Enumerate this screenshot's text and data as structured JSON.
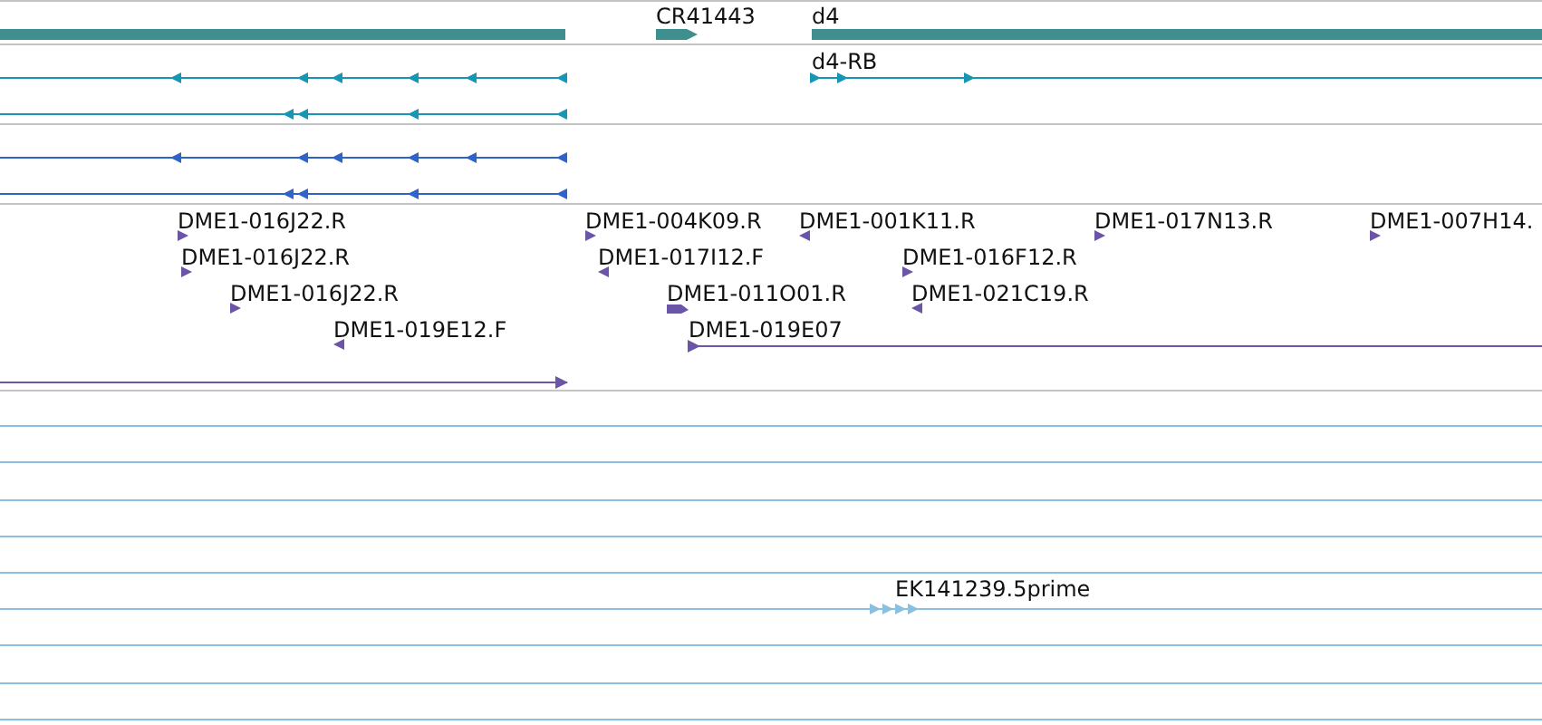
{
  "tracks": [
    {
      "kind": "genes",
      "features": [
        {
          "reverse": true
        },
        {
          "label": "CR41443",
          "reverse": false
        },
        {
          "label": "d4",
          "reverse": false
        }
      ]
    },
    {
      "kind": "transcripts",
      "features": [
        {
          "reverse": true
        },
        {
          "reverse": true
        },
        {
          "label": "d4-RB",
          "reverse": false
        }
      ]
    },
    {
      "kind": "transcripts",
      "features": [
        {
          "reverse": true
        },
        {
          "reverse": true
        }
      ]
    },
    {
      "kind": "ests",
      "features": [
        {
          "label": "DME1-016J22.R",
          "reverse": false
        },
        {
          "label": "DME1-004K09.R",
          "reverse": false
        },
        {
          "label": "DME1-001K11.R",
          "reverse": true
        },
        {
          "label": "DME1-017N13.R",
          "reverse": false
        },
        {
          "label": "DME1-007H14.",
          "reverse": false
        },
        {
          "label": "DME1-016J22.R",
          "reverse": false
        },
        {
          "label": "DME1-017I12.F",
          "reverse": true
        },
        {
          "label": "DME1-016F12.R",
          "reverse": false
        },
        {
          "label": "DME1-016J22.R",
          "reverse": false
        },
        {
          "label": "DME1-011O01.R",
          "reverse": false
        },
        {
          "label": "DME1-021C19.R",
          "reverse": true
        },
        {
          "label": "DME1-019E12.F",
          "reverse": true
        },
        {
          "label": "DME1-019E07",
          "reverse": false
        },
        {
          "reverse": false
        }
      ]
    },
    {
      "kind": "alignments",
      "features": [
        {
          "label": "EK141239.5prime",
          "reverse": false
        }
      ]
    }
  ]
}
